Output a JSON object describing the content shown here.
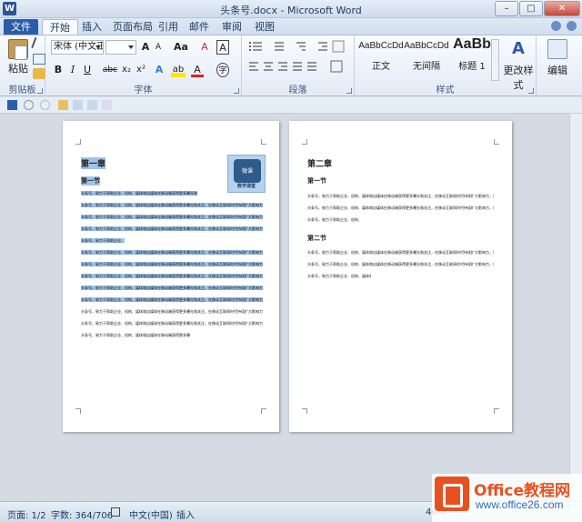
{
  "window": {
    "title": "头条号.docx - Microsoft Word",
    "app_icon_letter": "W",
    "min": "–",
    "max": "□",
    "close": "✕"
  },
  "tabs": {
    "file": "文件",
    "items": [
      "开始",
      "插入",
      "页面布局",
      "引用",
      "邮件",
      "审阅",
      "视图"
    ],
    "active": "开始"
  },
  "ribbon": {
    "clipboard": {
      "label": "剪贴板",
      "paste": "粘贴"
    },
    "font": {
      "label": "字体",
      "font_name": "宋体 (中文正文)",
      "font_size": "",
      "grow": "A",
      "shrink": "A",
      "change_case": "Aa",
      "clear_format": "A",
      "bold": "B",
      "italic": "I",
      "underline": "U",
      "strike": "abc",
      "subscript": "x₂",
      "superscript": "x²",
      "effects": "A",
      "highlight": "ab",
      "font_color": "A",
      "char_border": "A",
      "enclose": "字"
    },
    "paragraph": {
      "label": "段落"
    },
    "styles": {
      "label": "样式",
      "items": [
        {
          "sample": "AaBbCcDd",
          "name": "正文"
        },
        {
          "sample": "AaBbCcDd",
          "name": "无间隔"
        },
        {
          "sample": "AaBb",
          "name": "标题 1"
        }
      ],
      "change_styles": "更改样式"
    },
    "editing": {
      "label": "编辑"
    }
  },
  "colors": {
    "file_tab": "#2a5caa",
    "selection": "#9fc3ea",
    "watermark_orange": "#e8511f",
    "watermark_blue": "#2a6dbd"
  },
  "page1": {
    "chapter": "第一章",
    "section1": "第一节",
    "paragraphs": [
      "头条号，致力于帮助企业、机构、媒体和自媒体在移动端获得更多曝光和关注，在移动互联网时代持续扩大影响力，同时实现品牌传播和内容变现。",
      "头条号，致力于帮助企业、机构、媒体和自媒体在移动端获得更多曝光和关注，在移动互联网时代持续扩大影响力，同时实现品牌传播和内容变现。头条号，致力于帮助企业、机构、媒体和自媒体在移动端获得更多曝光和关注。",
      "头条号，致力于帮助企业、机构、媒体和自媒体在移动端获得更多曝光和关注，在移动互联网时代持续扩大影响力，同时实现品牌传播和内容变现。头条号，致力于帮助企业、机构、媒体和自媒体在移动端获得更多曝光和关注。",
      "头条号，致力于帮助企业、机构、媒体和自媒体在移动端获得更多曝光和关注，在移动互联网时代持续扩大影响力，同时实现品牌传播和内容变现。头条号，致力于帮助企业、机构、媒体和自媒体在移动端获得更多曝光和关注。"
    ],
    "logo_icon": "微课",
    "logo_text": "教学课堂"
  },
  "page2": {
    "chapter": "第二章",
    "section1": "第一节",
    "section2": "第二节",
    "paragraphs": [
      "头条号，致力于帮助企业、机构、媒体和自媒体在移动端获得更多曝光和关注，在移动互联网时代持续扩大影响力，同时实现品牌传播和内容变现。头条号，致力于帮助企业、机构、媒体和自媒体在移动端获得更多曝光和关注。",
      "头条号，致力于帮助企业、机构、媒体和自媒体在移动端获得更多曝光和关注，在移动互联网时代持续扩大影响力，同时实现品牌传播和内容变现。头条号，致力于帮助企业、机构、媒体和自媒体在移动端获得更多曝光和关注。"
    ]
  },
  "statusbar": {
    "page": "页面: 1/2",
    "words": "字数: 364/706",
    "language": "中文(中国)",
    "mode": "插入",
    "zoom": "46%"
  },
  "watermark": {
    "title": "Office教程网",
    "url": "www.office26.com"
  }
}
